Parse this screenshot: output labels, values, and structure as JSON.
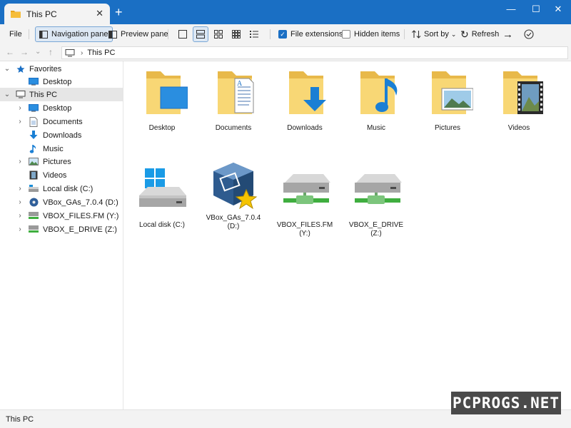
{
  "window": {
    "tab_title": "This PC",
    "tab_close": "✕",
    "new_tab": "+",
    "minimize": "—",
    "maximize": "☐",
    "close": "✕"
  },
  "commandbar": {
    "file": "File",
    "navigation_pane": "Navigation pane",
    "preview_pane": "Preview pane",
    "file_extensions": "File extensions",
    "file_extensions_checked": true,
    "hidden_items": "Hidden items",
    "hidden_items_checked": false,
    "sort_by": "Sort by",
    "refresh": "Refresh"
  },
  "address": {
    "back": "←",
    "forward": "→",
    "recent": "⌄",
    "up": "↑",
    "crumb": "This PC"
  },
  "sidebar": {
    "items": [
      {
        "label": "Favorites",
        "icon": "star-icon",
        "caret": "⌄"
      },
      {
        "label": "Desktop",
        "icon": "desktop-icon"
      },
      {
        "label": "This PC",
        "icon": "pc-icon",
        "caret": "⌄",
        "selected": true
      },
      {
        "label": "Desktop",
        "icon": "desktop-icon",
        "caret": "›"
      },
      {
        "label": "Documents",
        "icon": "document-icon",
        "caret": "›"
      },
      {
        "label": "Downloads",
        "icon": "download-icon"
      },
      {
        "label": "Music",
        "icon": "music-icon"
      },
      {
        "label": "Pictures",
        "icon": "picture-icon",
        "caret": "›"
      },
      {
        "label": "Videos",
        "icon": "video-icon"
      },
      {
        "label": "Local disk (C:)",
        "icon": "drive-icon",
        "caret": "›"
      },
      {
        "label": "VBox_GAs_7.0.4 (D:)",
        "icon": "cd-drive-icon",
        "caret": "›"
      },
      {
        "label": "VBOX_FILES.FM (Y:)",
        "icon": "network-drive-icon",
        "caret": "›"
      },
      {
        "label": "VBOX_E_DRIVE (Z:)",
        "icon": "network-drive-icon",
        "caret": "›"
      }
    ]
  },
  "main": {
    "folders": [
      {
        "label": "Desktop",
        "icon": "desktop-folder-icon"
      },
      {
        "label": "Documents",
        "icon": "documents-folder-icon"
      },
      {
        "label": "Downloads",
        "icon": "downloads-folder-icon"
      },
      {
        "label": "Music",
        "icon": "music-folder-icon"
      },
      {
        "label": "Pictures",
        "icon": "pictures-folder-icon"
      },
      {
        "label": "Videos",
        "icon": "videos-folder-icon"
      }
    ],
    "drives": [
      {
        "label_line1": "Local disk (C:)",
        "label_line2": "",
        "icon": "windows-drive-icon"
      },
      {
        "label_line1": "VBox_GAs_7.0.4",
        "label_line2": "(D:)",
        "icon": "virtualbox-cd-icon"
      },
      {
        "label_line1": "VBOX_FILES.FM",
        "label_line2": "(Y:)",
        "icon": "network-drive-icon"
      },
      {
        "label_line1": "VBOX_E_DRIVE",
        "label_line2": "(Z:)",
        "icon": "network-drive-icon"
      }
    ]
  },
  "status": {
    "text": "This PC"
  },
  "watermark": "PCPROGS.NET",
  "colors": {
    "accent": "#1a6fc4",
    "folder": "#f8d775",
    "folder_back": "#e8b94a"
  }
}
